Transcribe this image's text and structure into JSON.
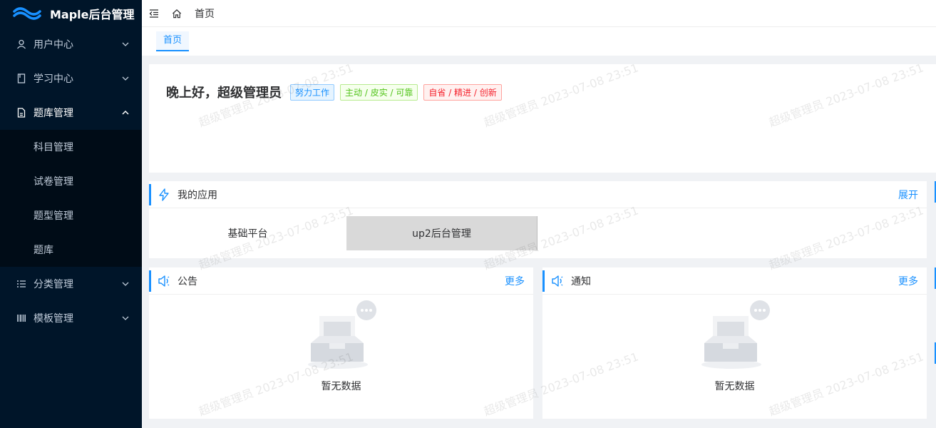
{
  "app": {
    "title": "Maple后台管理"
  },
  "sidebar": {
    "items": [
      {
        "label": "用户中心",
        "icon": "user-icon",
        "expanded": false
      },
      {
        "label": "学习中心",
        "icon": "book-icon",
        "expanded": false
      },
      {
        "label": "题库管理",
        "icon": "document-icon",
        "expanded": true,
        "children": [
          {
            "label": "科目管理"
          },
          {
            "label": "试卷管理"
          },
          {
            "label": "题型管理"
          },
          {
            "label": "题库"
          }
        ]
      },
      {
        "label": "分类管理",
        "icon": "list-icon",
        "expanded": false
      },
      {
        "label": "模板管理",
        "icon": "barcode-icon",
        "expanded": false
      }
    ]
  },
  "header": {
    "breadcrumb": "首页"
  },
  "tags": {
    "active": "首页"
  },
  "greeting": {
    "text": "晚上好，超级管理员",
    "badges": [
      "努力工作",
      "主动 / 皮实 / 可靠",
      "自省 / 精进 / 创新"
    ]
  },
  "apps": {
    "title": "我的应用",
    "expand_label": "展开",
    "items": [
      "基础平台",
      "up2后台管理"
    ]
  },
  "announcement": {
    "title": "公告",
    "more_label": "更多",
    "empty_text": "暂无数据"
  },
  "notification": {
    "title": "通知",
    "more_label": "更多",
    "empty_text": "暂无数据"
  },
  "watermark": "超级管理员 2023-07-08 23:51",
  "colors": {
    "sidebar_bg": "#001529",
    "accent": "#1890ff"
  }
}
